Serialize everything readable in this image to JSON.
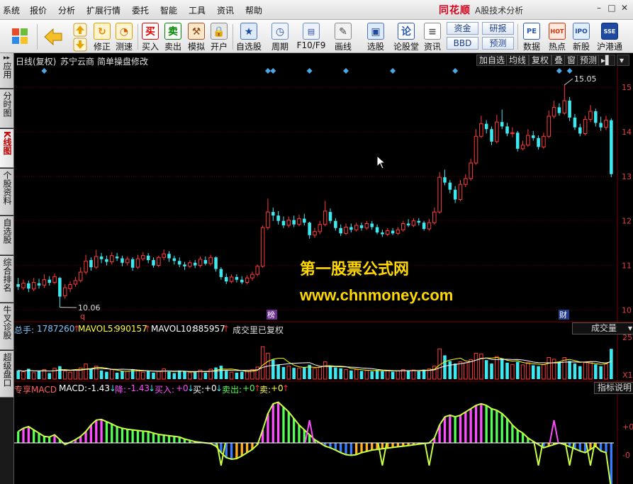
{
  "menu": {
    "items": [
      "系统",
      "报价",
      "分析",
      "扩展行情",
      "委托",
      "智能",
      "工具",
      "资讯",
      "帮助"
    ],
    "brand": "同花顺",
    "app_title": "A股技术分析"
  },
  "toolbar": {
    "buttons": [
      {
        "label": "修正",
        "icon": "refresh-icon"
      },
      {
        "label": "测速",
        "icon": "clock-icon"
      },
      {
        "label": "买入",
        "glyph": "买"
      },
      {
        "label": "卖出",
        "glyph": "卖"
      },
      {
        "label": "模拟",
        "icon": "hammer-icon"
      },
      {
        "label": "开户",
        "icon": "lock-icon"
      },
      {
        "label": "自选股",
        "icon": "star-icon"
      },
      {
        "label": "周期",
        "icon": "period-icon"
      },
      {
        "label": "F10/F9",
        "icon": "f10-icon"
      },
      {
        "label": "画线",
        "icon": "pencil-icon"
      },
      {
        "label": "选股",
        "icon": "screen-icon"
      },
      {
        "label": "论股堂",
        "glyph": "论"
      },
      {
        "label": "资讯",
        "icon": "document-icon"
      },
      {
        "label": "数据",
        "glyph": "PE"
      },
      {
        "label": "热点",
        "glyph": "HOT"
      },
      {
        "label": "新股",
        "glyph": "IPO"
      },
      {
        "label": "沪港通",
        "glyph": "SSE"
      }
    ],
    "small_buttons": [
      "资金",
      "研报",
      "BBD",
      "预测"
    ]
  },
  "left_tabs": [
    {
      "label": "应用",
      "active": false
    },
    {
      "label": "分时图",
      "active": false
    },
    {
      "label": "K线图",
      "active": true
    },
    {
      "label": "个股资料",
      "active": false
    },
    {
      "label": "自选股",
      "active": false
    },
    {
      "label": "综合排名",
      "active": false
    },
    {
      "label": "牛叉诊股",
      "active": false
    },
    {
      "label": "超级盘口",
      "active": false
    }
  ],
  "chart_header": {
    "period": "日线(复权)",
    "stock": "苏宁云商",
    "formula": "简单操盘修改",
    "buttons": [
      "加自选",
      "均线",
      "复权",
      "叠",
      "窗",
      "预测"
    ]
  },
  "price_axis": {
    "labels": [
      "15",
      "14",
      "13",
      "12",
      "11",
      "10"
    ]
  },
  "price_annotations": {
    "high": "15.05",
    "low": "10.06",
    "marker_q": "q",
    "marker_bang": "榜",
    "marker_cai": "财"
  },
  "volume": {
    "total_label": "总手:",
    "total": "1787260",
    "mavol5_label": "MAVOL5:",
    "mavol5": "990157",
    "mavol10_label": "MAVOL10:",
    "mavol10": "885957",
    "note": "成交里已复权",
    "selector": "成交量",
    "axis_labels": [
      "25",
      "X1"
    ]
  },
  "macd": {
    "name": "专享MACD",
    "macd_label": "MACD:",
    "macd_value": "-1.43",
    "fall_label": "降:",
    "fall_value": "-1.43",
    "buy_in_label": "买入:",
    "buy_in_value": "+0",
    "buy_label": "买:",
    "buy_value": "+0",
    "sell_out_label": "卖出:",
    "sell_out_value": "+0",
    "sell_label": "卖:",
    "sell_value": "+0",
    "help_button": "指标说明",
    "axis_labels": [
      "+0",
      "-0"
    ]
  },
  "watermark": {
    "line1": "第一股票公式网",
    "line2": "www.chnmoney.com"
  },
  "colors": {
    "up": "#ff3b3b",
    "down": "#3ee8f0",
    "ma5": "#ffffff",
    "ma10": "#ffff00",
    "macd_pos": "#ff4cff",
    "macd_neg": "#55ff55",
    "brand": "#d8001a"
  },
  "chart_data": [
    {
      "type": "candlestick",
      "title": "苏宁云商 日线(复权)",
      "yaxis_ticks": [
        10,
        11,
        12,
        13,
        14,
        15
      ],
      "ylim": [
        9.8,
        15.4
      ],
      "candles": [
        [
          10.58,
          10.52,
          10.72,
          10.45
        ],
        [
          10.5,
          10.6,
          10.68,
          10.45
        ],
        [
          10.6,
          10.48,
          10.66,
          10.4
        ],
        [
          10.47,
          10.62,
          10.72,
          10.42
        ],
        [
          10.6,
          10.55,
          10.7,
          10.48
        ],
        [
          10.56,
          10.68,
          10.8,
          10.5
        ],
        [
          10.68,
          10.61,
          10.76,
          10.55
        ],
        [
          10.62,
          10.75,
          10.82,
          10.58
        ],
        [
          10.72,
          10.3,
          10.74,
          10.06
        ],
        [
          10.32,
          10.5,
          10.58,
          10.25
        ],
        [
          10.48,
          10.57,
          10.64,
          10.4
        ],
        [
          10.58,
          10.66,
          10.74,
          10.52
        ],
        [
          10.66,
          10.85,
          10.96,
          10.62
        ],
        [
          10.85,
          11.1,
          11.24,
          10.8
        ],
        [
          11.12,
          10.96,
          11.18,
          10.88
        ],
        [
          10.96,
          11.2,
          11.35,
          10.92
        ],
        [
          11.2,
          11.14,
          11.28,
          11.05
        ],
        [
          11.14,
          11.08,
          11.22,
          11.0
        ],
        [
          11.08,
          11.22,
          11.3,
          11.02
        ],
        [
          11.2,
          11.16,
          11.28,
          11.1
        ],
        [
          11.16,
          11.06,
          11.22,
          10.98
        ],
        [
          11.06,
          11.14,
          11.2,
          11.0
        ],
        [
          11.14,
          10.95,
          11.18,
          10.88
        ],
        [
          10.96,
          11.15,
          11.24,
          10.92
        ],
        [
          11.15,
          11.22,
          11.3,
          11.1
        ],
        [
          11.22,
          11.12,
          11.28,
          11.05
        ],
        [
          11.12,
          11.0,
          11.18,
          10.95
        ],
        [
          11.0,
          11.18,
          11.22,
          10.96
        ],
        [
          11.18,
          11.26,
          11.36,
          11.12
        ],
        [
          11.26,
          11.16,
          11.32,
          11.08
        ],
        [
          11.16,
          11.1,
          11.22,
          11.02
        ],
        [
          11.1,
          11.02,
          11.18,
          10.96
        ],
        [
          11.02,
          10.98,
          11.08,
          10.9
        ],
        [
          10.98,
          11.06,
          11.12,
          10.94
        ],
        [
          11.06,
          11.0,
          11.12,
          10.94
        ],
        [
          11.0,
          11.14,
          11.2,
          10.96
        ],
        [
          11.12,
          11.04,
          11.2,
          11.0
        ],
        [
          11.04,
          11.18,
          11.24,
          11.0
        ],
        [
          11.18,
          10.92,
          11.2,
          10.86
        ],
        [
          10.92,
          10.74,
          10.96,
          10.68
        ],
        [
          10.74,
          10.64,
          10.82,
          10.58
        ],
        [
          10.64,
          10.74,
          10.8,
          10.6
        ],
        [
          10.74,
          10.68,
          10.8,
          10.62
        ],
        [
          10.68,
          10.62,
          10.76,
          10.58
        ],
        [
          10.62,
          10.72,
          10.78,
          10.58
        ],
        [
          10.72,
          10.8,
          10.86,
          10.66
        ],
        [
          10.8,
          10.98,
          11.02,
          10.76
        ],
        [
          10.98,
          11.85,
          11.9,
          10.95
        ],
        [
          11.85,
          12.2,
          12.5,
          11.8
        ],
        [
          12.2,
          12.12,
          12.3,
          12.0
        ],
        [
          12.12,
          12.0,
          12.22,
          11.92
        ],
        [
          12.0,
          11.9,
          12.1,
          11.84
        ],
        [
          11.9,
          12.02,
          12.1,
          11.85
        ],
        [
          12.02,
          11.92,
          12.12,
          11.86
        ],
        [
          11.92,
          12.05,
          12.14,
          11.88
        ],
        [
          12.05,
          11.96,
          12.16,
          11.9
        ],
        [
          11.96,
          11.68,
          11.98,
          11.6
        ],
        [
          11.68,
          11.76,
          11.84,
          11.62
        ],
        [
          11.76,
          11.92,
          12.0,
          11.7
        ],
        [
          11.92,
          12.22,
          12.45,
          11.88
        ],
        [
          12.2,
          12.0,
          12.28,
          11.94
        ],
        [
          12.0,
          11.84,
          12.06,
          11.78
        ],
        [
          11.84,
          11.72,
          11.92,
          11.66
        ],
        [
          11.72,
          11.86,
          11.94,
          11.68
        ],
        [
          11.86,
          11.8,
          11.94,
          11.74
        ],
        [
          11.8,
          11.9,
          11.96,
          11.76
        ],
        [
          11.9,
          11.84,
          11.96,
          11.78
        ],
        [
          11.84,
          11.94,
          12.0,
          11.8
        ],
        [
          11.94,
          11.86,
          12.0,
          11.8
        ],
        [
          11.86,
          11.74,
          11.92,
          11.7
        ],
        [
          11.74,
          11.7,
          11.8,
          11.64
        ],
        [
          11.7,
          11.78,
          11.84,
          11.66
        ],
        [
          11.78,
          11.72,
          11.84,
          11.68
        ],
        [
          11.72,
          11.8,
          11.86,
          11.68
        ],
        [
          11.8,
          11.94,
          12.0,
          11.76
        ],
        [
          11.94,
          11.9,
          12.04,
          11.86
        ],
        [
          11.9,
          12.0,
          12.06,
          11.86
        ],
        [
          12.0,
          11.96,
          12.06,
          11.9
        ],
        [
          11.96,
          11.82,
          12.0,
          11.78
        ],
        [
          11.82,
          11.96,
          12.04,
          11.78
        ],
        [
          11.96,
          12.2,
          12.3,
          11.92
        ],
        [
          12.2,
          12.98,
          13.1,
          12.16
        ],
        [
          12.98,
          12.86,
          13.15,
          12.8
        ],
        [
          12.86,
          12.7,
          12.92,
          12.62
        ],
        [
          12.7,
          12.48,
          12.78,
          12.4
        ],
        [
          12.48,
          12.82,
          12.92,
          12.44
        ],
        [
          12.82,
          12.95,
          13.05,
          12.76
        ],
        [
          12.95,
          13.3,
          13.4,
          12.9
        ],
        [
          13.3,
          13.9,
          14.06,
          13.26
        ],
        [
          13.9,
          14.18,
          14.36,
          13.86
        ],
        [
          14.18,
          14.06,
          14.26,
          13.96
        ],
        [
          14.06,
          13.78,
          14.12,
          13.7
        ],
        [
          13.78,
          14.22,
          14.38,
          13.74
        ],
        [
          14.22,
          14.12,
          14.5,
          14.06
        ],
        [
          14.12,
          13.96,
          14.2,
          13.9
        ],
        [
          13.96,
          13.98,
          14.1,
          13.88
        ],
        [
          13.98,
          13.62,
          14.02,
          13.56
        ],
        [
          13.62,
          13.7,
          13.8,
          13.58
        ],
        [
          13.7,
          13.92,
          14.06,
          13.66
        ],
        [
          13.92,
          13.86,
          14.02,
          13.8
        ],
        [
          13.86,
          13.66,
          13.92,
          13.6
        ],
        [
          13.66,
          13.9,
          13.98,
          13.62
        ],
        [
          13.9,
          14.35,
          14.48,
          13.86
        ],
        [
          14.35,
          14.55,
          14.7,
          14.3
        ],
        [
          14.55,
          14.42,
          14.64,
          14.36
        ],
        [
          14.42,
          14.7,
          15.05,
          14.38
        ],
        [
          14.7,
          14.32,
          14.78,
          14.24
        ],
        [
          14.32,
          14.1,
          14.4,
          14.04
        ],
        [
          14.1,
          13.96,
          14.18,
          13.9
        ],
        [
          13.96,
          14.28,
          14.36,
          13.92
        ],
        [
          14.28,
          14.46,
          14.6,
          14.22
        ],
        [
          14.46,
          14.2,
          14.52,
          14.12
        ],
        [
          14.2,
          14.1,
          14.34,
          14.02
        ],
        [
          14.1,
          14.26,
          14.36,
          14.04
        ],
        [
          14.26,
          13.05,
          14.3,
          12.98
        ]
      ]
    },
    {
      "type": "bar",
      "title": "成交量",
      "series": [
        {
          "name": "VOL",
          "values": [
            0.2,
            0.17,
            0.24,
            0.15,
            0.19,
            0.22,
            0.14,
            0.25,
            0.3,
            0.19,
            0.16,
            0.21,
            0.26,
            0.35,
            0.24,
            0.3,
            0.2,
            0.17,
            0.22,
            0.15,
            0.19,
            0.18,
            0.23,
            0.21,
            0.16,
            0.19,
            0.15,
            0.18,
            0.24,
            0.17,
            0.14,
            0.2,
            0.18,
            0.15,
            0.16,
            0.21,
            0.15,
            0.23,
            0.27,
            0.31,
            0.19,
            0.16,
            0.15,
            0.17,
            0.2,
            0.22,
            0.28,
            0.75,
            0.6,
            0.45,
            0.33,
            0.28,
            0.3,
            0.26,
            0.25,
            0.27,
            0.33,
            0.25,
            0.28,
            0.4,
            0.3,
            0.27,
            0.25,
            0.22,
            0.2,
            0.22,
            0.19,
            0.2,
            0.18,
            0.21,
            0.18,
            0.2,
            0.17,
            0.19,
            0.22,
            0.2,
            0.21,
            0.18,
            0.22,
            0.24,
            0.3,
            0.7,
            0.55,
            0.42,
            0.36,
            0.4,
            0.38,
            0.45,
            0.6,
            0.58,
            0.44,
            0.36,
            0.52,
            0.48,
            0.38,
            0.34,
            0.4,
            0.33,
            0.38,
            0.32,
            0.3,
            0.34,
            0.5,
            0.46,
            0.4,
            0.5,
            0.42,
            0.36,
            0.3,
            0.38,
            0.4,
            0.34,
            0.3,
            0.35,
            0.7
          ]
        }
      ]
    },
    {
      "type": "bar",
      "title": "专享MACD",
      "series": [
        {
          "name": "MACD",
          "values": [
            0.35,
            0.45,
            0.5,
            0.4,
            0.3,
            0.2,
            0.18,
            0.25,
            0.1,
            -0.05,
            0.02,
            0.1,
            0.2,
            0.35,
            0.55,
            0.7,
            0.72,
            0.65,
            0.58,
            0.5,
            0.45,
            0.42,
            0.4,
            0.38,
            0.36,
            0.35,
            0.3,
            0.26,
            0.24,
            0.22,
            0.2,
            0.18,
            0.12,
            0.08,
            0.04,
            0.02,
            0.0,
            -0.02,
            -0.1,
            -0.3,
            -0.45,
            -0.5,
            -0.48,
            -0.4,
            -0.3,
            -0.2,
            -0.05,
            0.4,
            0.9,
            1.2,
            1.25,
            1.1,
            0.95,
            0.75,
            0.55,
            0.4,
            0.25,
            0.1,
            0.0,
            -0.1,
            -0.15,
            -0.22,
            -0.3,
            -0.36,
            -0.38,
            -0.36,
            -0.3,
            -0.26,
            -0.22,
            -0.2,
            -0.18,
            -0.16,
            -0.14,
            -0.12,
            -0.1,
            -0.08,
            -0.06,
            -0.04,
            -0.02,
            0.0,
            0.15,
            0.55,
            0.8,
            0.85,
            0.8,
            0.85,
            0.95,
            1.05,
            1.15,
            1.2,
            1.15,
            1.05,
            1.0,
            0.9,
            0.75,
            0.55,
            0.4,
            0.3,
            0.15,
            0.05,
            -0.05,
            -0.15,
            -0.1,
            -0.05,
            0.0,
            -0.05,
            -0.12,
            -0.18,
            -0.25,
            -0.3,
            -0.2,
            -0.1,
            -0.25,
            -0.3,
            -1.43
          ]
        }
      ]
    }
  ]
}
